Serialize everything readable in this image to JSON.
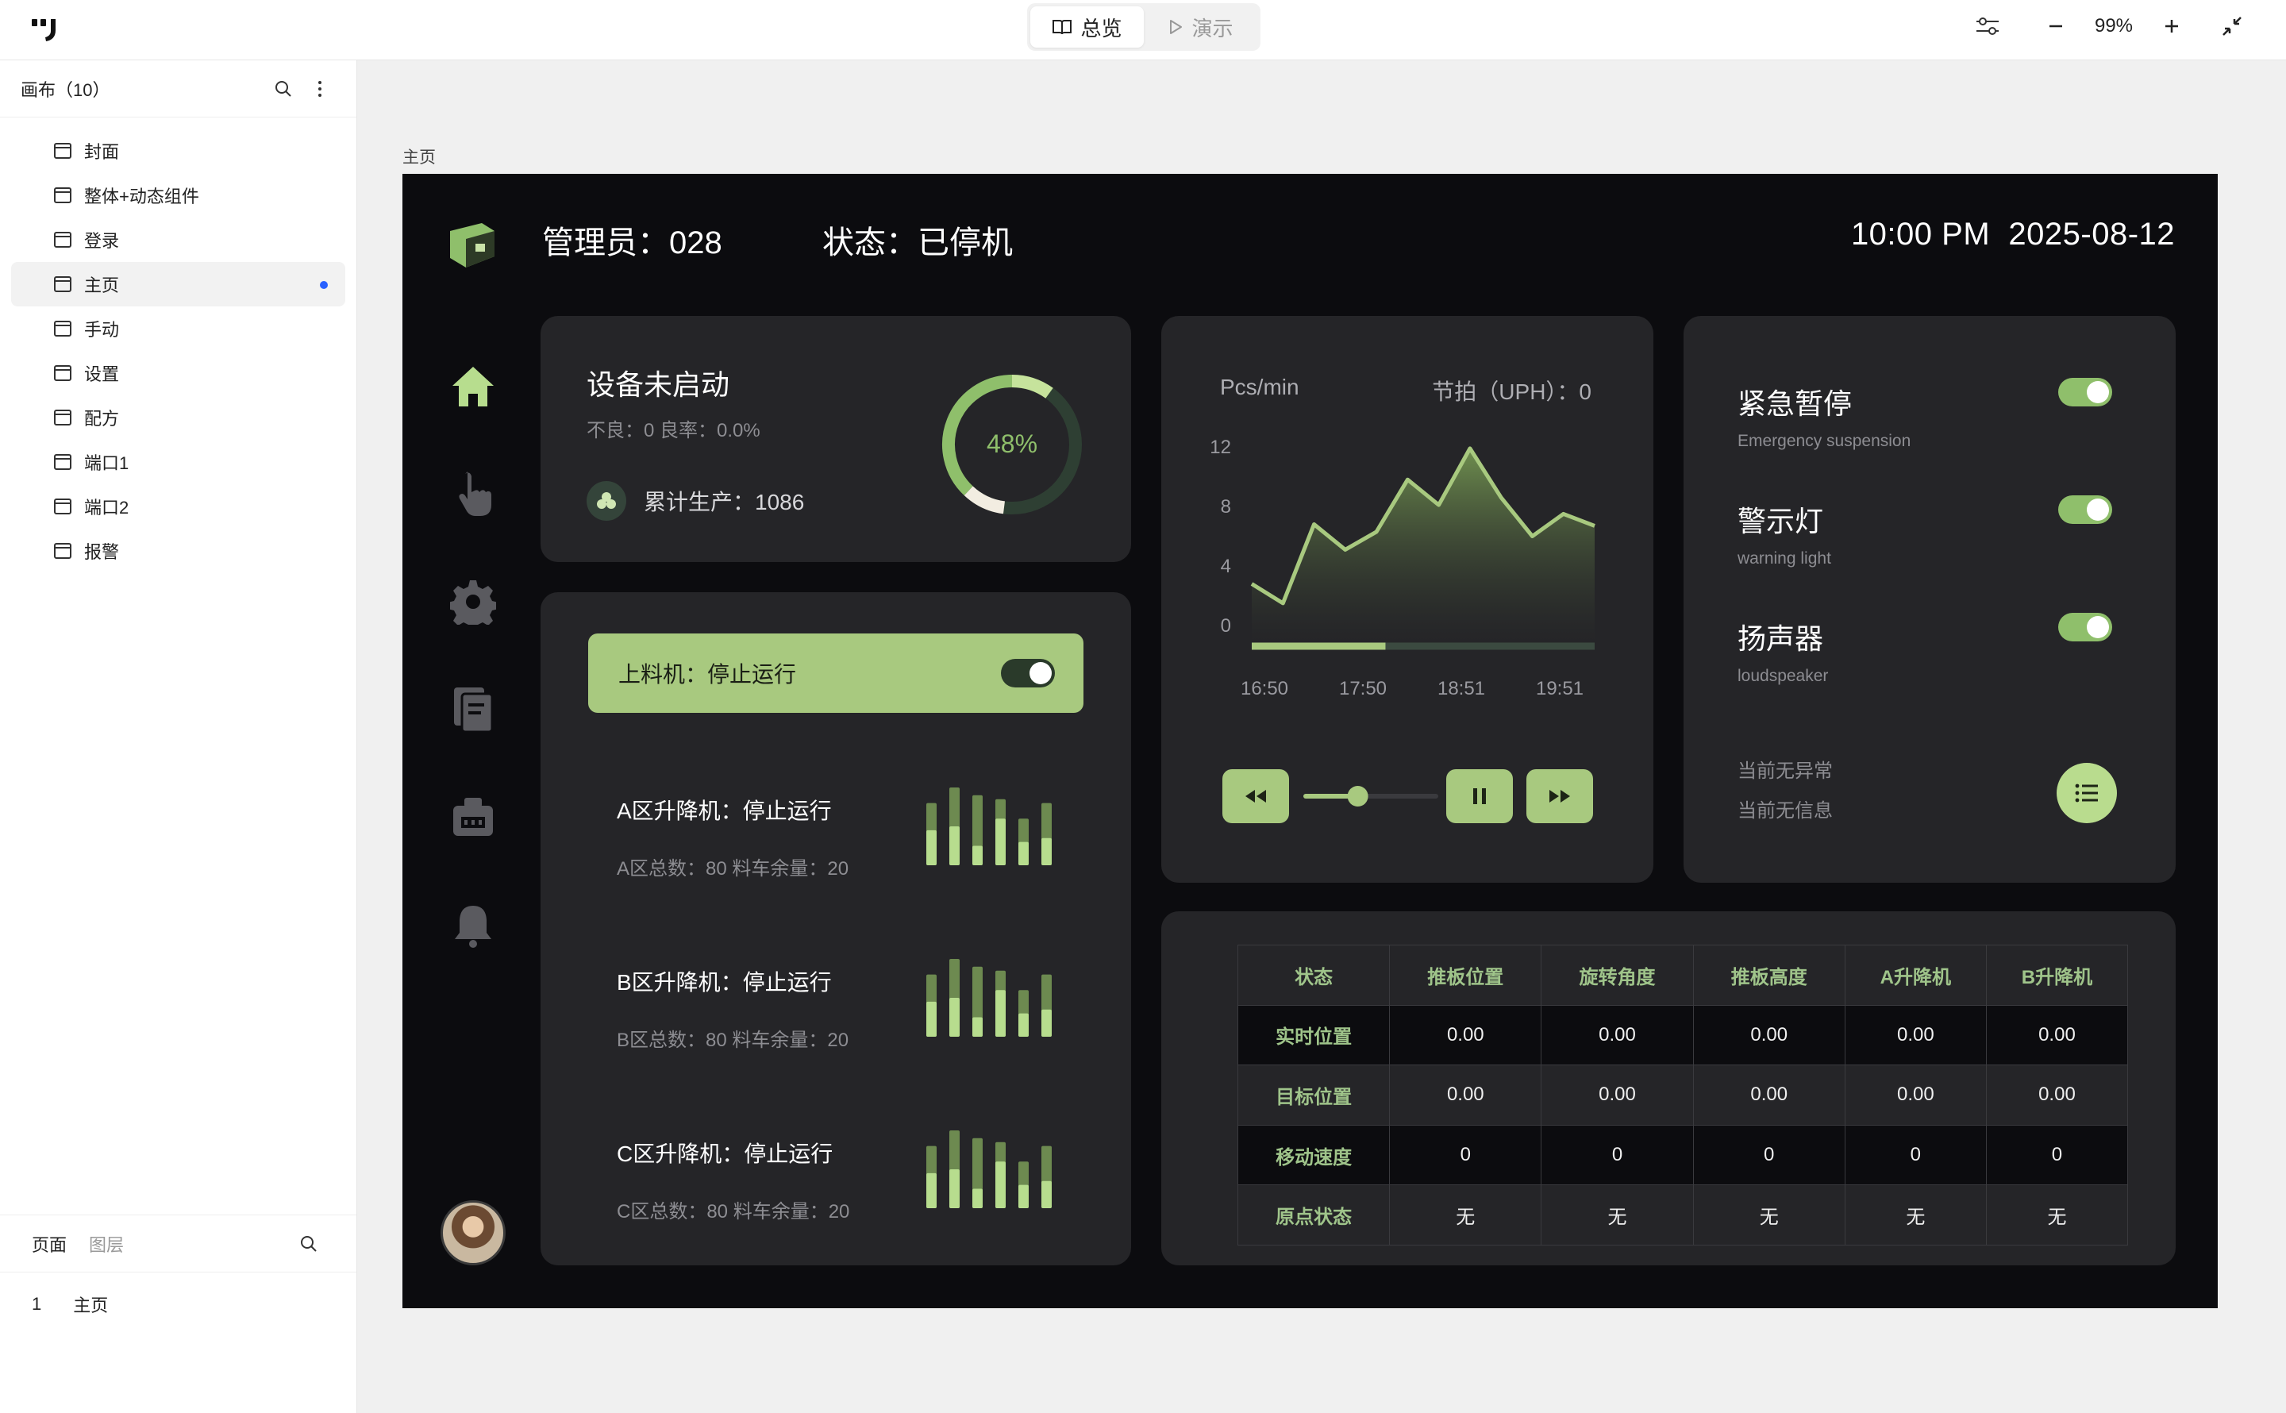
{
  "topbar": {
    "tabs": [
      {
        "label": "总览"
      },
      {
        "label": "演示"
      }
    ],
    "zoom": "99%"
  },
  "sidebar": {
    "title": "画布（10）",
    "pages": [
      {
        "label": "封面"
      },
      {
        "label": "整体+动态组件"
      },
      {
        "label": "登录"
      },
      {
        "label": "主页"
      },
      {
        "label": "手动"
      },
      {
        "label": "设置"
      },
      {
        "label": "配方"
      },
      {
        "label": "端口1"
      },
      {
        "label": "端口2"
      },
      {
        "label": "报警"
      }
    ],
    "active_page": "主页",
    "bottom_tabs": {
      "pages": "页面",
      "layers": "图层"
    },
    "layer": {
      "index": "1",
      "name": "主页"
    }
  },
  "canvas": {
    "frame_label": "主页"
  },
  "dashboard": {
    "admin": "管理员：028",
    "status": "状态：已停机",
    "time": "10:00 PM",
    "date": "2025-08-12",
    "device": {
      "title": "设备未启动",
      "sub": "不良：0  良率：0.0%",
      "production": "累计生产：1086",
      "percent_label": "48%",
      "percent": 48
    },
    "feeder": {
      "label": "上料机：停止运行",
      "on": true
    },
    "lifts": [
      {
        "title": "A区升降机：停止运行",
        "sub": "A区总数：80  料车余量：20"
      },
      {
        "title": "B区升降机：停止运行",
        "sub": "B区总数：80  料车余量：20"
      },
      {
        "title": "C区升降机：停止运行",
        "sub": "C区总数：80  料车余量：20"
      }
    ],
    "chart": {
      "unit": "Pcs/min",
      "uph": "节拍（UPH）：0",
      "slider_progress": 0.39,
      "speed_slider": 0.4
    },
    "switches": [
      {
        "cn": "紧急暂停",
        "en": "Emergency suspension",
        "on": true
      },
      {
        "cn": "警示灯",
        "en": "warning light",
        "on": true
      },
      {
        "cn": "扬声器",
        "en": "loudspeaker",
        "on": true
      }
    ],
    "info": [
      "当前无异常",
      "当前无信息"
    ],
    "table": {
      "headers": [
        "状态",
        "推板位置",
        "旋转角度",
        "推板高度",
        "A升降机",
        "B升降机"
      ],
      "rows": [
        [
          "实时位置",
          "0.00",
          "0.00",
          "0.00",
          "0.00",
          "0.00"
        ],
        [
          "目标位置",
          "0.00",
          "0.00",
          "0.00",
          "0.00",
          "0.00"
        ],
        [
          "移动速度",
          "0",
          "0",
          "0",
          "0",
          "0"
        ],
        [
          "原点状态",
          "无",
          "无",
          "无",
          "无",
          "无"
        ]
      ]
    }
  },
  "chart_data": {
    "type": "area",
    "x": [
      "16:50",
      "",
      "17:50",
      "",
      "18:51",
      "",
      "19:51",
      ""
    ],
    "xticks": [
      "16:50",
      "17:50",
      "18:51",
      "19:51"
    ],
    "yticks": [
      "12",
      "8",
      "4",
      "0"
    ],
    "ylim": [
      0,
      12
    ],
    "ylabel": "Pcs/min",
    "series": [
      {
        "values": [
          2.8,
          1.5,
          6.8,
          5.1,
          6.3,
          9.8,
          8.1,
          11.9,
          8.6,
          6.0,
          7.5,
          6.7
        ]
      }
    ],
    "colors": {
      "line": "#a8c97f"
    }
  },
  "colors": {
    "accent": "#a8c97f",
    "frame_bg": "#0c0c0f",
    "card_bg": "#252528"
  }
}
